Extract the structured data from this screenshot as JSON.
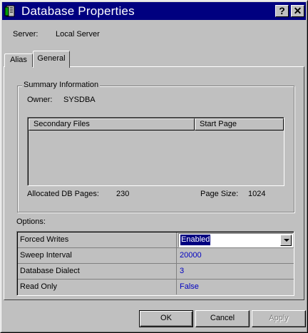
{
  "window": {
    "title": "Database Properties",
    "help_label": "?",
    "close_label": "✕"
  },
  "server": {
    "label": "Server:",
    "value": "Local Server"
  },
  "tabs": [
    {
      "label": "Alias"
    },
    {
      "label": "General"
    }
  ],
  "summary": {
    "title": "Summary Information",
    "owner_label": "Owner:",
    "owner_value": "SYSDBA",
    "columns": [
      "Secondary Files",
      "Start Page"
    ],
    "allocated_label": "Allocated DB Pages:",
    "allocated_value": "230",
    "pagesize_label": "Page Size:",
    "pagesize_value": "1024"
  },
  "options": {
    "label": "Options:",
    "rows": [
      {
        "name": "Forced Writes",
        "value": "Enabled"
      },
      {
        "name": "Sweep Interval",
        "value": "20000"
      },
      {
        "name": "Database Dialect",
        "value": "3"
      },
      {
        "name": "Read Only",
        "value": "False"
      }
    ]
  },
  "buttons": {
    "ok": "OK",
    "cancel": "Cancel",
    "apply": "Apply"
  },
  "colors": {
    "titlebar": "#000080",
    "value_text": "#0000c0",
    "face": "#c0c0c0"
  }
}
